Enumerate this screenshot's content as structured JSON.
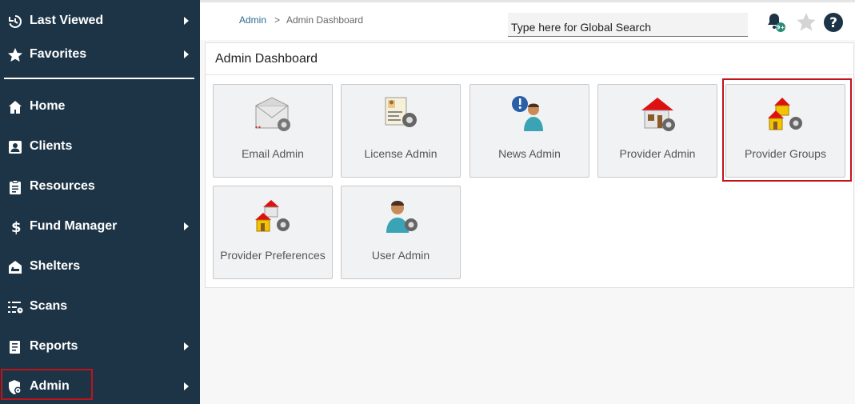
{
  "sidebar": {
    "items": [
      {
        "label": "Last Viewed",
        "icon": "history-icon"
      },
      {
        "label": "Favorites",
        "icon": "star-icon"
      },
      {
        "label": "Home",
        "icon": "home-icon"
      },
      {
        "label": "Clients",
        "icon": "contact-card-icon"
      },
      {
        "label": "Resources",
        "icon": "clipboard-icon"
      },
      {
        "label": "Fund Manager",
        "icon": "dollar-icon"
      },
      {
        "label": "Shelters",
        "icon": "shelter-icon"
      },
      {
        "label": "Scans",
        "icon": "scan-list-icon"
      },
      {
        "label": "Reports",
        "icon": "report-icon"
      },
      {
        "label": "Admin",
        "icon": "admin-shield-icon"
      }
    ]
  },
  "breadcrumb": {
    "parent": "Admin",
    "separator": ">",
    "current": "Admin Dashboard"
  },
  "search": {
    "placeholder": "Type here for Global Search"
  },
  "notifications": {
    "badge": "9+"
  },
  "panel": {
    "title": "Admin Dashboard"
  },
  "tiles": [
    {
      "label": "Email Admin",
      "icon": "email-gear-icon"
    },
    {
      "label": "License Admin",
      "icon": "license-gear-icon"
    },
    {
      "label": "News Admin",
      "icon": "news-person-icon"
    },
    {
      "label": "Provider Admin",
      "icon": "provider-house-gear-icon"
    },
    {
      "label": "Provider Groups",
      "icon": "provider-group-houses-icon"
    },
    {
      "label": "Provider Preferences",
      "icon": "provider-preferences-icon"
    },
    {
      "label": "User Admin",
      "icon": "user-gear-icon"
    }
  ],
  "colors": {
    "sidebar_bg": "#1d3446",
    "highlight": "#c0141b",
    "link": "#2a6a8f"
  }
}
